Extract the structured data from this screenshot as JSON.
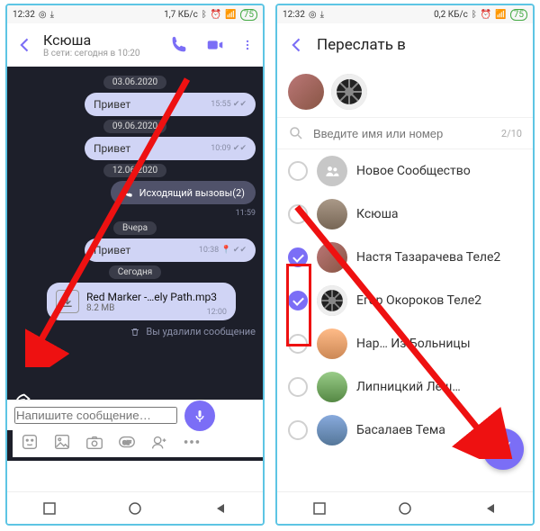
{
  "statusbar1": {
    "time": "12:32",
    "net": "1,7 КБ/с",
    "battery": "75"
  },
  "statusbar2": {
    "time": "12:32",
    "net": "0,2 КБ/с",
    "battery": "75"
  },
  "chat": {
    "name": "Ксюша",
    "status": "В сети: сегодня в 10:20",
    "dates": {
      "d1": "03.06.2020",
      "d2": "09.06.2020",
      "d3": "12.06.2020",
      "d4": "Вчера",
      "d5": "Сегодня"
    },
    "msgs": {
      "m1": {
        "text": "Привет",
        "time": "15:55"
      },
      "m2": {
        "text": "Привет",
        "time": "10:09"
      },
      "m3_call": {
        "text": "Исходящий вызовы(2)",
        "time": "11:59"
      },
      "m4": {
        "text": "Привет",
        "time": "10:38"
      },
      "file": {
        "name": "Red Marker -…ely Path.mp3",
        "size": "8.2 MB",
        "time": "12:00"
      },
      "deleted": "Вы удалили сообщение"
    },
    "composer": {
      "placeholder": "Напишите сообщение…"
    }
  },
  "forward": {
    "title": "Переслать в",
    "search_placeholder": "Введите имя или номер",
    "counter": "2/10",
    "items": {
      "i0": "Новое Сообщество",
      "i1": "Ксюша",
      "i2": "Настя Тазарачева Теле2",
      "i3": "Егор Окороков Теле2",
      "i4": "Нар… Из Больницы",
      "i5": "Липницкий Леш…",
      "i6": "Басалаев Тема"
    }
  }
}
